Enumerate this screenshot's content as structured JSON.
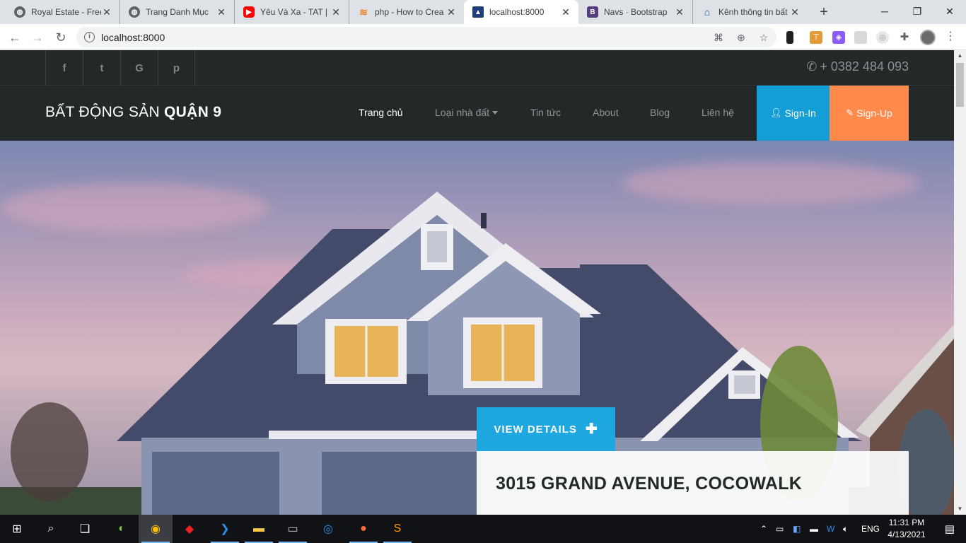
{
  "browser": {
    "tabs": [
      {
        "title": "Royal Estate - Free",
        "icon": "globe-icon"
      },
      {
        "title": "Trang Danh Mục",
        "icon": "globe-icon"
      },
      {
        "title": "Yêu Và Xa - TAT | M",
        "icon": "youtube-icon"
      },
      {
        "title": "php - How to Crea",
        "icon": "stackoverflow-icon"
      },
      {
        "title": "localhost:8000",
        "icon": "site-icon",
        "active": true
      },
      {
        "title": "Navs · Bootstrap",
        "icon": "bootstrap-icon"
      },
      {
        "title": "Kênh thông tin bất",
        "icon": "house-icon"
      }
    ],
    "close_glyph": "✕",
    "new_tab_glyph": "+",
    "url": "localhost:8000"
  },
  "site": {
    "social": [
      "f",
      "t",
      "G",
      "p"
    ],
    "phone": "+ 0382 484 093",
    "brand_light": "BẤT ĐỘNG SẢN ",
    "brand_bold": "QUẬN 9",
    "nav": {
      "home": "Trang chủ",
      "types": "Loại nhà đất",
      "news": "Tin tức",
      "about": "About",
      "blog": "Blog",
      "contact": "Liên hệ"
    },
    "signin": "Sign-In",
    "signup": "Sign-Up",
    "hero": {
      "button": "VIEW DETAILS",
      "address": "3015 GRAND AVENUE, COCOWALK"
    },
    "colors": {
      "dark": "#232829",
      "signin": "#159ed6",
      "signup": "#ff8a4c",
      "details": "#1fa8e0"
    }
  },
  "taskbar": {
    "lang": "ENG",
    "time": "11:31 PM",
    "date": "4/13/2021",
    "apps": [
      "start-icon",
      "search-icon",
      "task-view-icon",
      "app-green-icon",
      "chrome-icon",
      "app-red-icon",
      "vscode-icon",
      "explorer-icon",
      "terminal-icon",
      "app-blue-icon",
      "postman-icon",
      "sublime-icon"
    ]
  }
}
